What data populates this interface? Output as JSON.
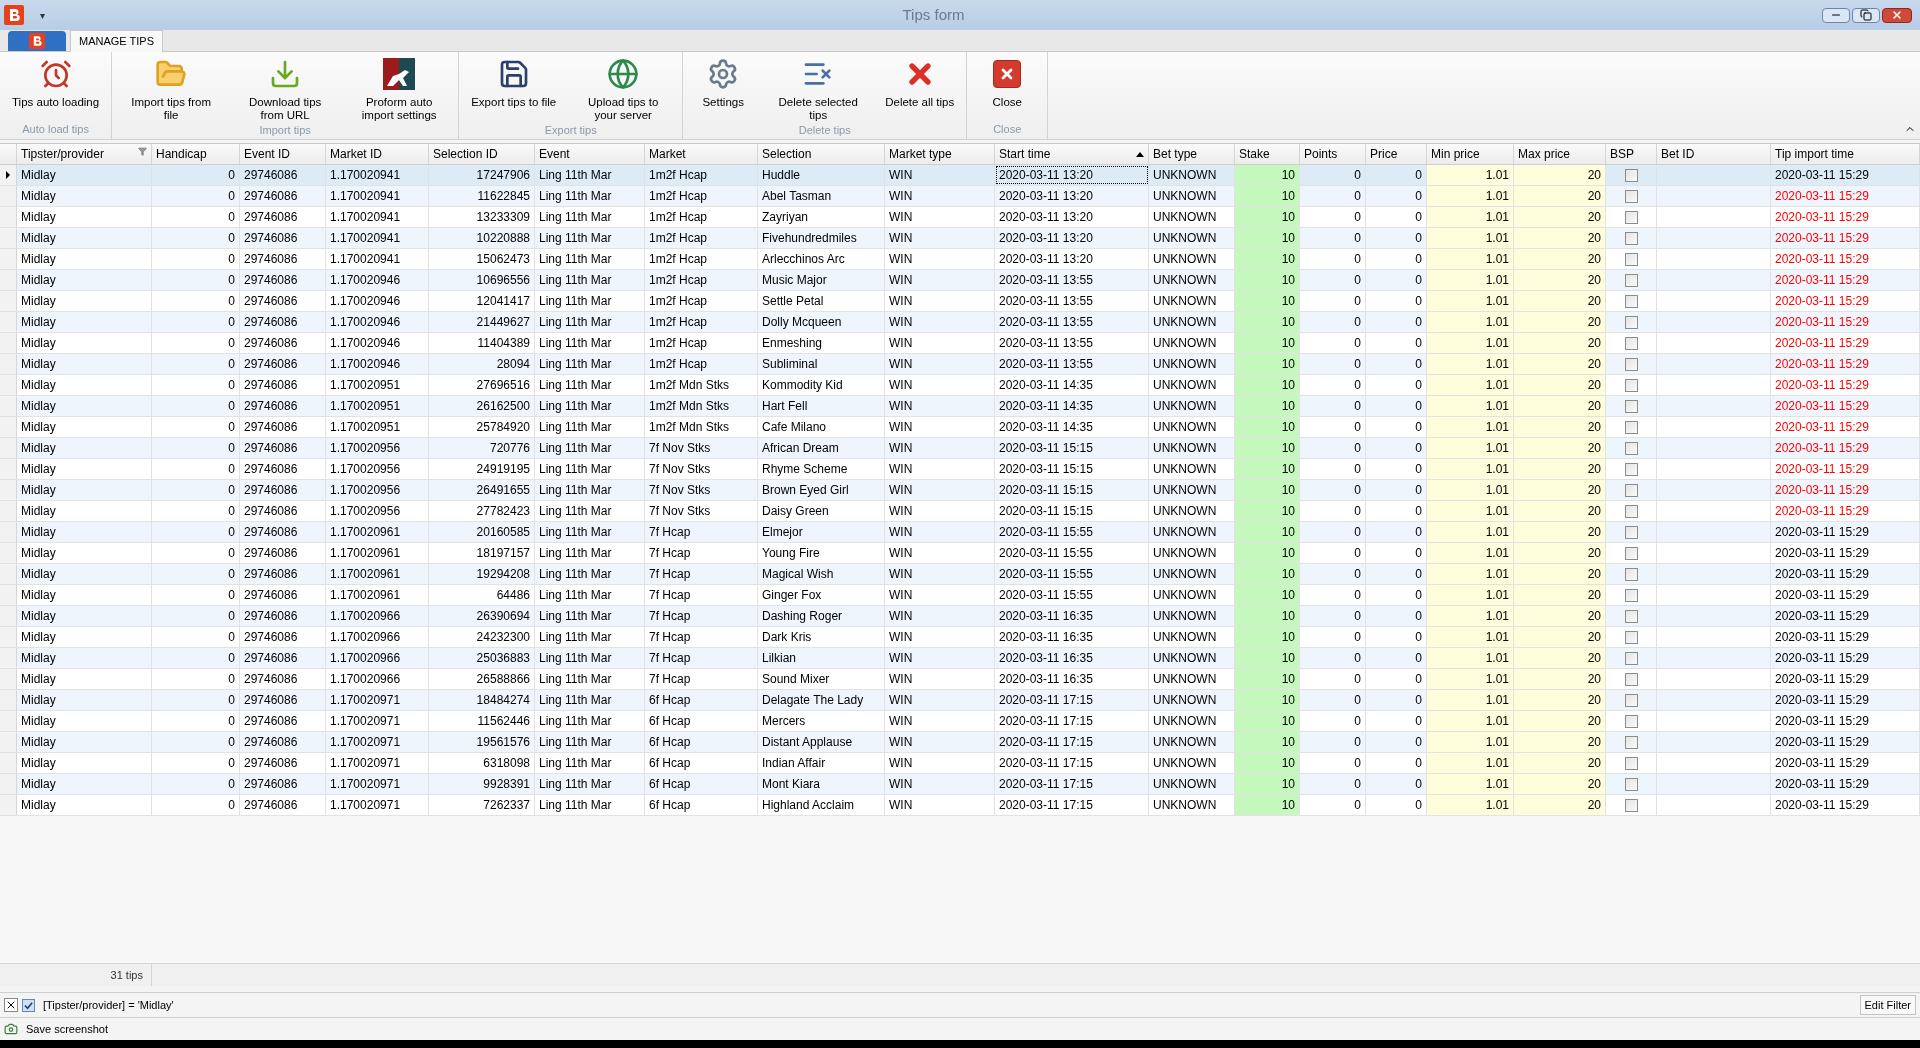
{
  "window": {
    "title": "Tips form",
    "quick_access": "▾"
  },
  "ribbon_tabs": [
    {
      "label": "MANAGE TIPS",
      "selected": true
    }
  ],
  "ribbon_groups": [
    {
      "label": "Auto load tips",
      "buttons": [
        {
          "label": "Tips auto loading"
        }
      ]
    },
    {
      "label": "Import tips",
      "buttons": [
        {
          "label": "Import tips from file"
        },
        {
          "label": "Download tips from URL"
        },
        {
          "label": "Proform auto import settings"
        }
      ]
    },
    {
      "label": "Export tips",
      "buttons": [
        {
          "label": "Export tips to file"
        },
        {
          "label": "Upload tips to your server"
        }
      ]
    },
    {
      "label": "Delete tips",
      "buttons": [
        {
          "label": "Settings"
        },
        {
          "label": "Delete selected tips"
        },
        {
          "label": "Delete all tips"
        }
      ]
    },
    {
      "label": "Close",
      "buttons": [
        {
          "label": "Close"
        }
      ]
    }
  ],
  "table": {
    "columns": [
      {
        "label": "Tipster/provider",
        "kind": "text",
        "filtered": true,
        "sorted": false
      },
      {
        "label": "Handicap",
        "kind": "number",
        "filtered": false,
        "sorted": false
      },
      {
        "label": "Event ID",
        "kind": "text",
        "filtered": false,
        "sorted": false
      },
      {
        "label": "Market ID",
        "kind": "text",
        "filtered": false,
        "sorted": false
      },
      {
        "label": "Selection ID",
        "kind": "number",
        "filtered": false,
        "sorted": false
      },
      {
        "label": "Event",
        "kind": "text",
        "filtered": false,
        "sorted": false
      },
      {
        "label": "Market",
        "kind": "text",
        "filtered": false,
        "sorted": false
      },
      {
        "label": "Selection",
        "kind": "text",
        "filtered": false,
        "sorted": false
      },
      {
        "label": "Market type",
        "kind": "text",
        "filtered": false,
        "sorted": false
      },
      {
        "label": "Start time",
        "kind": "text",
        "filtered": false,
        "sorted": true
      },
      {
        "label": "Bet type",
        "kind": "text",
        "filtered": false,
        "sorted": false
      },
      {
        "label": "Stake",
        "kind": "number",
        "color": "#c4f8bc",
        "filtered": false,
        "sorted": false
      },
      {
        "label": "Points",
        "kind": "number",
        "filtered": false,
        "sorted": false
      },
      {
        "label": "Price",
        "kind": "number",
        "filtered": false,
        "sorted": false
      },
      {
        "label": "Min price",
        "kind": "number",
        "color": "#fdfcdb",
        "filtered": false,
        "sorted": false
      },
      {
        "label": "Max price",
        "kind": "number",
        "color": "#fdfcdb",
        "filtered": false,
        "sorted": false
      },
      {
        "label": "BSP",
        "kind": "check",
        "filtered": false,
        "sorted": false
      },
      {
        "label": "Bet ID",
        "kind": "blank",
        "filtered": false,
        "sorted": false
      },
      {
        "label": "Tip import time",
        "kind": "import",
        "filtered": false,
        "sorted": false
      }
    ],
    "rows": [
      {
        "selected": true,
        "alert": false,
        "bsp": false,
        "cells": [
          "Midlay",
          "0",
          "29746086",
          "1.170020941",
          "17247906",
          "Ling  11th Mar",
          "1m2f Hcap",
          "Huddle",
          "WIN",
          "2020-03-11 13:20",
          "UNKNOWN",
          "10",
          "0",
          "0",
          "1.01",
          "20"
        ],
        "import_time": "2020-03-11 15:29"
      },
      {
        "selected": false,
        "alert": true,
        "bsp": false,
        "cells": [
          "Midlay",
          "0",
          "29746086",
          "1.170020941",
          "11622845",
          "Ling  11th Mar",
          "1m2f Hcap",
          "Abel Tasman",
          "WIN",
          "2020-03-11 13:20",
          "UNKNOWN",
          "10",
          "0",
          "0",
          "1.01",
          "20"
        ],
        "import_time": "2020-03-11 15:29"
      },
      {
        "selected": false,
        "alert": true,
        "bsp": false,
        "cells": [
          "Midlay",
          "0",
          "29746086",
          "1.170020941",
          "13233309",
          "Ling  11th Mar",
          "1m2f Hcap",
          "Zayriyan",
          "WIN",
          "2020-03-11 13:20",
          "UNKNOWN",
          "10",
          "0",
          "0",
          "1.01",
          "20"
        ],
        "import_time": "2020-03-11 15:29"
      },
      {
        "selected": false,
        "alert": true,
        "bsp": false,
        "cells": [
          "Midlay",
          "0",
          "29746086",
          "1.170020941",
          "10220888",
          "Ling  11th Mar",
          "1m2f Hcap",
          "Fivehundredmiles",
          "WIN",
          "2020-03-11 13:20",
          "UNKNOWN",
          "10",
          "0",
          "0",
          "1.01",
          "20"
        ],
        "import_time": "2020-03-11 15:29"
      },
      {
        "selected": false,
        "alert": true,
        "bsp": false,
        "cells": [
          "Midlay",
          "0",
          "29746086",
          "1.170020941",
          "15062473",
          "Ling  11th Mar",
          "1m2f Hcap",
          "Arlecchinos Arc",
          "WIN",
          "2020-03-11 13:20",
          "UNKNOWN",
          "10",
          "0",
          "0",
          "1.01",
          "20"
        ],
        "import_time": "2020-03-11 15:29"
      },
      {
        "selected": false,
        "alert": true,
        "bsp": false,
        "cells": [
          "Midlay",
          "0",
          "29746086",
          "1.170020946",
          "10696556",
          "Ling  11th Mar",
          "1m2f Hcap",
          "Music Major",
          "WIN",
          "2020-03-11 13:55",
          "UNKNOWN",
          "10",
          "0",
          "0",
          "1.01",
          "20"
        ],
        "import_time": "2020-03-11 15:29"
      },
      {
        "selected": false,
        "alert": true,
        "bsp": false,
        "cells": [
          "Midlay",
          "0",
          "29746086",
          "1.170020946",
          "12041417",
          "Ling  11th Mar",
          "1m2f Hcap",
          "Settle Petal",
          "WIN",
          "2020-03-11 13:55",
          "UNKNOWN",
          "10",
          "0",
          "0",
          "1.01",
          "20"
        ],
        "import_time": "2020-03-11 15:29"
      },
      {
        "selected": false,
        "alert": true,
        "bsp": false,
        "cells": [
          "Midlay",
          "0",
          "29746086",
          "1.170020946",
          "21449627",
          "Ling  11th Mar",
          "1m2f Hcap",
          "Dolly Mcqueen",
          "WIN",
          "2020-03-11 13:55",
          "UNKNOWN",
          "10",
          "0",
          "0",
          "1.01",
          "20"
        ],
        "import_time": "2020-03-11 15:29"
      },
      {
        "selected": false,
        "alert": true,
        "bsp": false,
        "cells": [
          "Midlay",
          "0",
          "29746086",
          "1.170020946",
          "11404389",
          "Ling  11th Mar",
          "1m2f Hcap",
          "Enmeshing",
          "WIN",
          "2020-03-11 13:55",
          "UNKNOWN",
          "10",
          "0",
          "0",
          "1.01",
          "20"
        ],
        "import_time": "2020-03-11 15:29"
      },
      {
        "selected": false,
        "alert": true,
        "bsp": false,
        "cells": [
          "Midlay",
          "0",
          "29746086",
          "1.170020946",
          "28094",
          "Ling  11th Mar",
          "1m2f Hcap",
          "Subliminal",
          "WIN",
          "2020-03-11 13:55",
          "UNKNOWN",
          "10",
          "0",
          "0",
          "1.01",
          "20"
        ],
        "import_time": "2020-03-11 15:29"
      },
      {
        "selected": false,
        "alert": true,
        "bsp": false,
        "cells": [
          "Midlay",
          "0",
          "29746086",
          "1.170020951",
          "27696516",
          "Ling  11th Mar",
          "1m2f Mdn Stks",
          "Kommodity Kid",
          "WIN",
          "2020-03-11 14:35",
          "UNKNOWN",
          "10",
          "0",
          "0",
          "1.01",
          "20"
        ],
        "import_time": "2020-03-11 15:29"
      },
      {
        "selected": false,
        "alert": true,
        "bsp": false,
        "cells": [
          "Midlay",
          "0",
          "29746086",
          "1.170020951",
          "26162500",
          "Ling  11th Mar",
          "1m2f Mdn Stks",
          "Hart Fell",
          "WIN",
          "2020-03-11 14:35",
          "UNKNOWN",
          "10",
          "0",
          "0",
          "1.01",
          "20"
        ],
        "import_time": "2020-03-11 15:29"
      },
      {
        "selected": false,
        "alert": true,
        "bsp": false,
        "cells": [
          "Midlay",
          "0",
          "29746086",
          "1.170020951",
          "25784920",
          "Ling  11th Mar",
          "1m2f Mdn Stks",
          "Cafe Milano",
          "WIN",
          "2020-03-11 14:35",
          "UNKNOWN",
          "10",
          "0",
          "0",
          "1.01",
          "20"
        ],
        "import_time": "2020-03-11 15:29"
      },
      {
        "selected": false,
        "alert": true,
        "bsp": false,
        "cells": [
          "Midlay",
          "0",
          "29746086",
          "1.170020956",
          "720776",
          "Ling  11th Mar",
          "7f Nov Stks",
          "African Dream",
          "WIN",
          "2020-03-11 15:15",
          "UNKNOWN",
          "10",
          "0",
          "0",
          "1.01",
          "20"
        ],
        "import_time": "2020-03-11 15:29"
      },
      {
        "selected": false,
        "alert": true,
        "bsp": false,
        "cells": [
          "Midlay",
          "0",
          "29746086",
          "1.170020956",
          "24919195",
          "Ling  11th Mar",
          "7f Nov Stks",
          "Rhyme Scheme",
          "WIN",
          "2020-03-11 15:15",
          "UNKNOWN",
          "10",
          "0",
          "0",
          "1.01",
          "20"
        ],
        "import_time": "2020-03-11 15:29"
      },
      {
        "selected": false,
        "alert": true,
        "bsp": false,
        "cells": [
          "Midlay",
          "0",
          "29746086",
          "1.170020956",
          "26491655",
          "Ling  11th Mar",
          "7f Nov Stks",
          "Brown Eyed Girl",
          "WIN",
          "2020-03-11 15:15",
          "UNKNOWN",
          "10",
          "0",
          "0",
          "1.01",
          "20"
        ],
        "import_time": "2020-03-11 15:29"
      },
      {
        "selected": false,
        "alert": true,
        "bsp": false,
        "cells": [
          "Midlay",
          "0",
          "29746086",
          "1.170020956",
          "27782423",
          "Ling  11th Mar",
          "7f Nov Stks",
          "Daisy Green",
          "WIN",
          "2020-03-11 15:15",
          "UNKNOWN",
          "10",
          "0",
          "0",
          "1.01",
          "20"
        ],
        "import_time": "2020-03-11 15:29"
      },
      {
        "selected": false,
        "alert": false,
        "bsp": false,
        "cells": [
          "Midlay",
          "0",
          "29746086",
          "1.170020961",
          "20160585",
          "Ling  11th Mar",
          "7f Hcap",
          "Elmejor",
          "WIN",
          "2020-03-11 15:55",
          "UNKNOWN",
          "10",
          "0",
          "0",
          "1.01",
          "20"
        ],
        "import_time": "2020-03-11 15:29"
      },
      {
        "selected": false,
        "alert": false,
        "bsp": false,
        "cells": [
          "Midlay",
          "0",
          "29746086",
          "1.170020961",
          "18197157",
          "Ling  11th Mar",
          "7f Hcap",
          "Young Fire",
          "WIN",
          "2020-03-11 15:55",
          "UNKNOWN",
          "10",
          "0",
          "0",
          "1.01",
          "20"
        ],
        "import_time": "2020-03-11 15:29"
      },
      {
        "selected": false,
        "alert": false,
        "bsp": false,
        "cells": [
          "Midlay",
          "0",
          "29746086",
          "1.170020961",
          "19294208",
          "Ling  11th Mar",
          "7f Hcap",
          "Magical Wish",
          "WIN",
          "2020-03-11 15:55",
          "UNKNOWN",
          "10",
          "0",
          "0",
          "1.01",
          "20"
        ],
        "import_time": "2020-03-11 15:29"
      },
      {
        "selected": false,
        "alert": false,
        "bsp": false,
        "cells": [
          "Midlay",
          "0",
          "29746086",
          "1.170020961",
          "64486",
          "Ling  11th Mar",
          "7f Hcap",
          "Ginger Fox",
          "WIN",
          "2020-03-11 15:55",
          "UNKNOWN",
          "10",
          "0",
          "0",
          "1.01",
          "20"
        ],
        "import_time": "2020-03-11 15:29"
      },
      {
        "selected": false,
        "alert": false,
        "bsp": false,
        "cells": [
          "Midlay",
          "0",
          "29746086",
          "1.170020966",
          "26390694",
          "Ling  11th Mar",
          "7f Hcap",
          "Dashing Roger",
          "WIN",
          "2020-03-11 16:35",
          "UNKNOWN",
          "10",
          "0",
          "0",
          "1.01",
          "20"
        ],
        "import_time": "2020-03-11 15:29"
      },
      {
        "selected": false,
        "alert": false,
        "bsp": false,
        "cells": [
          "Midlay",
          "0",
          "29746086",
          "1.170020966",
          "24232300",
          "Ling  11th Mar",
          "7f Hcap",
          "Dark Kris",
          "WIN",
          "2020-03-11 16:35",
          "UNKNOWN",
          "10",
          "0",
          "0",
          "1.01",
          "20"
        ],
        "import_time": "2020-03-11 15:29"
      },
      {
        "selected": false,
        "alert": false,
        "bsp": false,
        "cells": [
          "Midlay",
          "0",
          "29746086",
          "1.170020966",
          "25036883",
          "Ling  11th Mar",
          "7f Hcap",
          "Lilkian",
          "WIN",
          "2020-03-11 16:35",
          "UNKNOWN",
          "10",
          "0",
          "0",
          "1.01",
          "20"
        ],
        "import_time": "2020-03-11 15:29"
      },
      {
        "selected": false,
        "alert": false,
        "bsp": false,
        "cells": [
          "Midlay",
          "0",
          "29746086",
          "1.170020966",
          "26588866",
          "Ling  11th Mar",
          "7f Hcap",
          "Sound Mixer",
          "WIN",
          "2020-03-11 16:35",
          "UNKNOWN",
          "10",
          "0",
          "0",
          "1.01",
          "20"
        ],
        "import_time": "2020-03-11 15:29"
      },
      {
        "selected": false,
        "alert": false,
        "bsp": false,
        "cells": [
          "Midlay",
          "0",
          "29746086",
          "1.170020971",
          "18484274",
          "Ling  11th Mar",
          "6f Hcap",
          "Delagate The Lady",
          "WIN",
          "2020-03-11 17:15",
          "UNKNOWN",
          "10",
          "0",
          "0",
          "1.01",
          "20"
        ],
        "import_time": "2020-03-11 15:29"
      },
      {
        "selected": false,
        "alert": false,
        "bsp": false,
        "cells": [
          "Midlay",
          "0",
          "29746086",
          "1.170020971",
          "11562446",
          "Ling  11th Mar",
          "6f Hcap",
          "Mercers",
          "WIN",
          "2020-03-11 17:15",
          "UNKNOWN",
          "10",
          "0",
          "0",
          "1.01",
          "20"
        ],
        "import_time": "2020-03-11 15:29"
      },
      {
        "selected": false,
        "alert": false,
        "bsp": false,
        "cells": [
          "Midlay",
          "0",
          "29746086",
          "1.170020971",
          "19561576",
          "Ling  11th Mar",
          "6f Hcap",
          "Distant Applause",
          "WIN",
          "2020-03-11 17:15",
          "UNKNOWN",
          "10",
          "0",
          "0",
          "1.01",
          "20"
        ],
        "import_time": "2020-03-11 15:29"
      },
      {
        "selected": false,
        "alert": false,
        "bsp": false,
        "cells": [
          "Midlay",
          "0",
          "29746086",
          "1.170020971",
          "6318098",
          "Ling  11th Mar",
          "6f Hcap",
          "Indian Affair",
          "WIN",
          "2020-03-11 17:15",
          "UNKNOWN",
          "10",
          "0",
          "0",
          "1.01",
          "20"
        ],
        "import_time": "2020-03-11 15:29"
      },
      {
        "selected": false,
        "alert": false,
        "bsp": false,
        "cells": [
          "Midlay",
          "0",
          "29746086",
          "1.170020971",
          "9928391",
          "Ling  11th Mar",
          "6f Hcap",
          "Mont Kiara",
          "WIN",
          "2020-03-11 17:15",
          "UNKNOWN",
          "10",
          "0",
          "0",
          "1.01",
          "20"
        ],
        "import_time": "2020-03-11 15:29"
      },
      {
        "selected": false,
        "alert": false,
        "bsp": false,
        "cells": [
          "Midlay",
          "0",
          "29746086",
          "1.170020971",
          "7262337",
          "Ling  11th Mar",
          "6f Hcap",
          "Highland Acclaim",
          "WIN",
          "2020-03-11 17:15",
          "UNKNOWN",
          "10",
          "0",
          "0",
          "1.01",
          "20"
        ],
        "import_time": "2020-03-11 15:29"
      }
    ],
    "footer": {
      "count": "31 tips"
    }
  },
  "filter_bar": {
    "enabled": true,
    "expression": "[Tipster/provider] = 'Midlay'",
    "edit_button": "Edit Filter"
  },
  "status_bar": {
    "action": "Save screenshot"
  }
}
